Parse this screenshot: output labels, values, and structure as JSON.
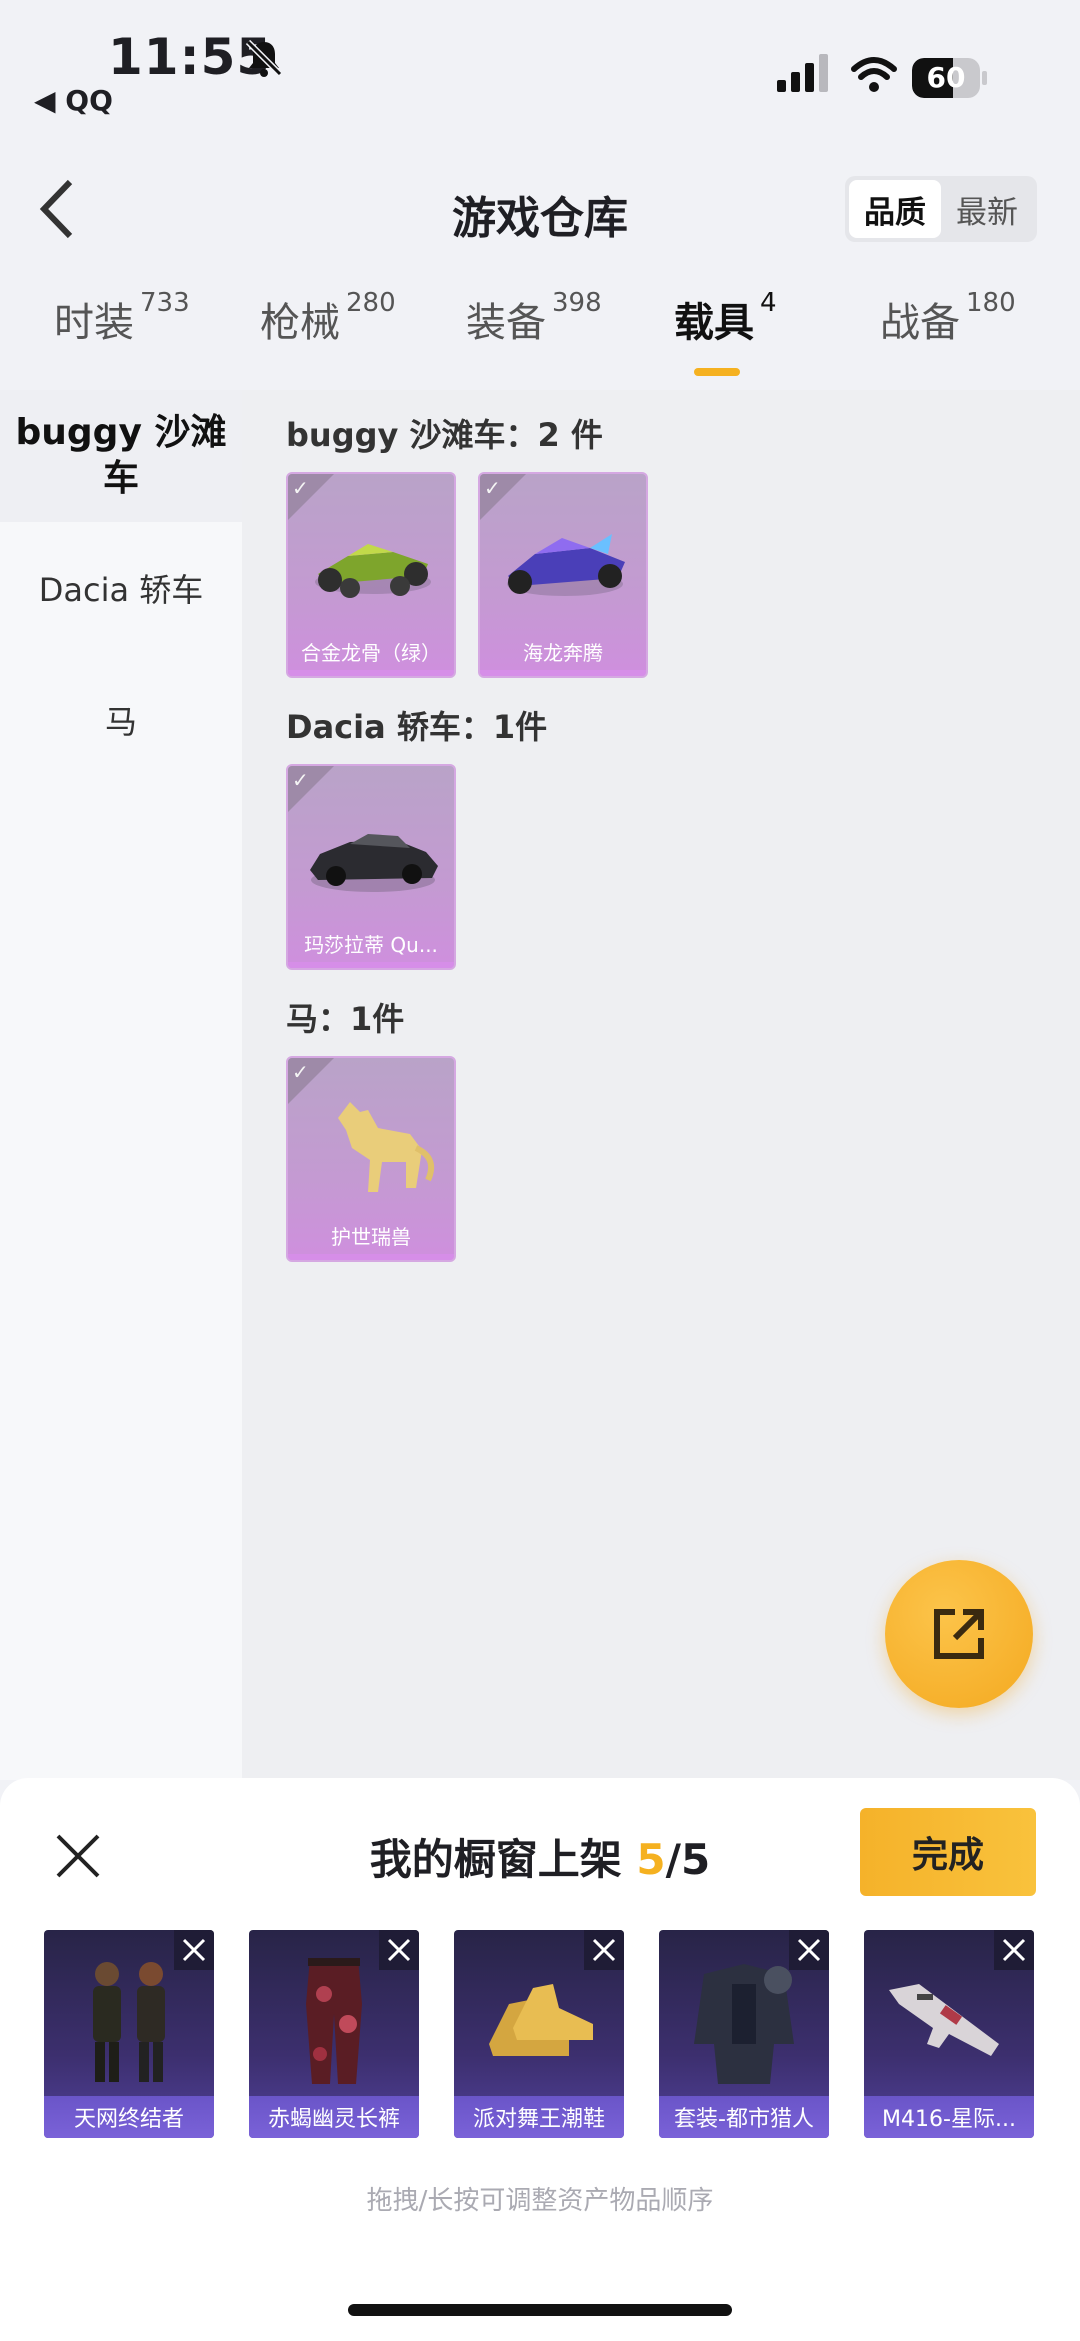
{
  "status": {
    "time": "11:55",
    "back_app": "◀ QQ",
    "battery": "60"
  },
  "header": {
    "title": "游戏仓库",
    "sort_options": [
      "品质",
      "最新"
    ],
    "sort_active": "品质"
  },
  "tabs": [
    {
      "label": "时装",
      "count": "733"
    },
    {
      "label": "枪械",
      "count": "280"
    },
    {
      "label": "装备",
      "count": "398"
    },
    {
      "label": "载具",
      "count": "4"
    },
    {
      "label": "战备",
      "count": "180"
    }
  ],
  "sidebar": {
    "items": [
      "buggy 沙滩车",
      "Dacia 轿车",
      "马"
    ]
  },
  "sections": [
    {
      "title": "buggy 沙滩车：2 件",
      "items": [
        "合金龙骨（绿）",
        "海龙奔腾"
      ]
    },
    {
      "title": "Dacia 轿车：1件",
      "items": [
        "玛莎拉蒂 Qu..."
      ]
    },
    {
      "title": "马：1件",
      "items": [
        "护世瑞兽"
      ]
    }
  ],
  "shelf": {
    "title": "我的橱窗上架",
    "count_current": "5",
    "count_total": "/5",
    "done_label": "完成",
    "items": [
      "天网终结者",
      "赤蝎幽灵长裤",
      "派对舞王潮鞋",
      "套装-都市猎人",
      "M416-星际..."
    ],
    "hint": "拖拽/长按可调整资产物品顺序"
  },
  "colors": {
    "accent": "#f5b120",
    "card_purple": "#c49ad2",
    "shelf_card": "#3c2f6e"
  }
}
